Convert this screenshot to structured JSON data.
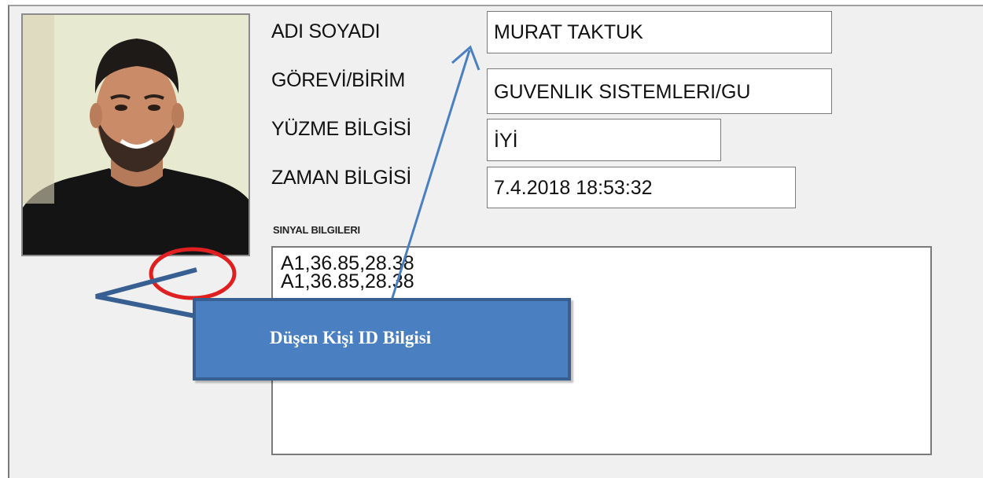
{
  "form": {
    "name_label": "ADI SOYADI",
    "name_value": "MURAT TAKTUK",
    "role_label": "GÖREVİ/BİRİM",
    "role_value": "GUVENLIK SISTEMLERI/GU",
    "swim_label": "YÜZME BİLGİSİ",
    "swim_value": "İYİ",
    "time_label": "ZAMAN BİLGİSİ",
    "time_value": "7.4.2018 18:53:32",
    "signal_label": "SINYAL BILGILERI",
    "signal_lines": [
      "A1,36.85,28.38",
      "A1,36.85,28.38"
    ]
  },
  "photo": {
    "icon": "person-photo"
  },
  "annotation": {
    "callout_text": "Düşen Kişi ID  Bilgisi",
    "callout_color": "#4a7fc1",
    "circle_color": "#e02020",
    "arrow_color": "#4a7fc1"
  }
}
